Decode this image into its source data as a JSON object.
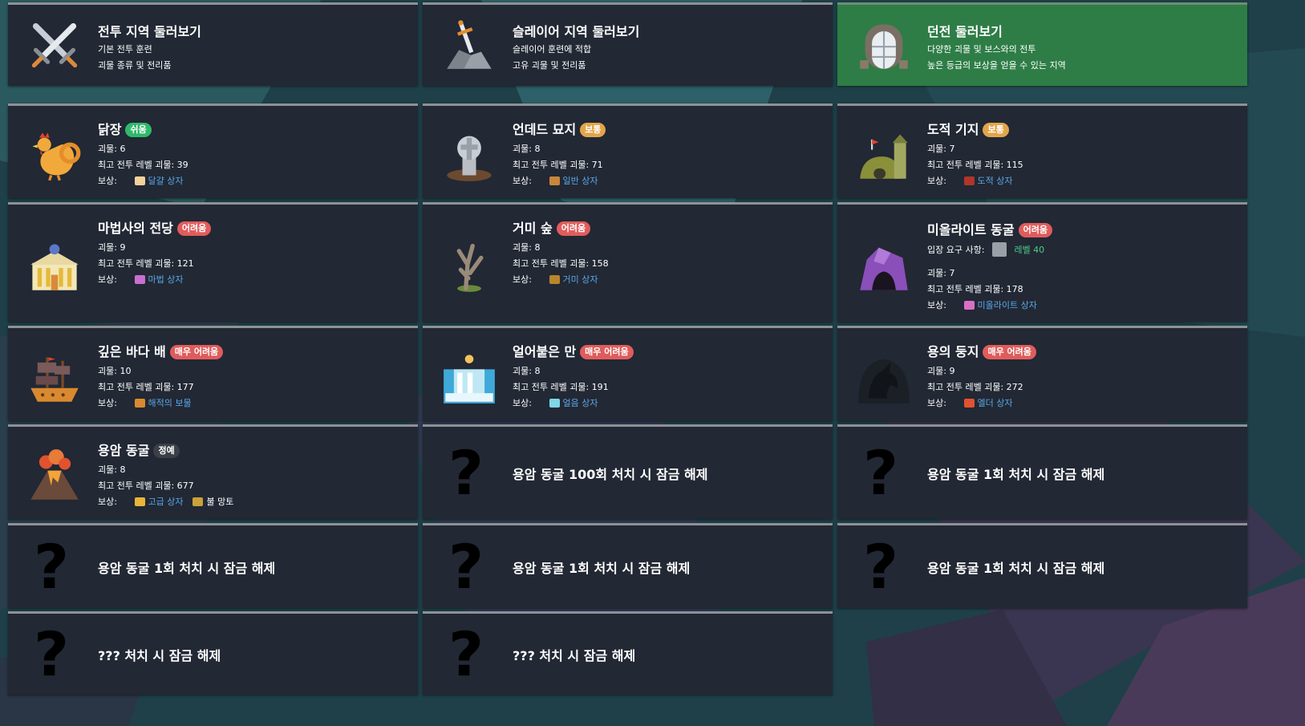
{
  "top_cards": [
    {
      "title": "전투 지역 둘러보기",
      "line1": "기본 전투 훈련",
      "line2": "괴물 종류 및 전리품",
      "icon": "crossed-swords-icon"
    },
    {
      "title": "슬레이어 지역 둘러보기",
      "line1": "슬레이어 훈련에 적합",
      "line2": "고유 괴물 및 전리품",
      "icon": "sword-in-stone-icon"
    },
    {
      "title": "던전 둘러보기",
      "line1": "다양한 괴물 및 보스와의 전투",
      "line2": "높은 등급의 보상을 얻을 수 있는 지역",
      "icon": "dungeon-door-icon",
      "color": "#2e7d46"
    }
  ],
  "labels": {
    "monsters": "괴물:",
    "max_level": "최고 전투 레벨 괴물:",
    "reward": "보상:",
    "requirement": "입장 요구 사항:"
  },
  "areas": [
    {
      "name": "닭장",
      "difficulty": "쉬움",
      "monsters": "6",
      "max_level": "39",
      "reward": "달걀 상자",
      "icon": "rooster-icon",
      "reward_color": "#f2d29b"
    },
    {
      "name": "언데드 묘지",
      "difficulty": "보통",
      "monsters": "8",
      "max_level": "71",
      "reward": "일반 상자",
      "icon": "gravestone-icon",
      "reward_color": "#c8873a"
    },
    {
      "name": "도적 기지",
      "difficulty": "보통",
      "monsters": "7",
      "max_level": "115",
      "reward": "도적 상자",
      "icon": "bandit-base-icon",
      "reward_color": "#b0362a"
    },
    {
      "name": "마법사의 전당",
      "difficulty": "어려움",
      "monsters": "9",
      "max_level": "121",
      "reward": "마법 상자",
      "icon": "wizard-hall-icon",
      "reward_color": "#c86fd1"
    },
    {
      "name": "거미 숲",
      "difficulty": "어려움",
      "monsters": "8",
      "max_level": "158",
      "reward": "거미 상자",
      "icon": "dead-tree-icon",
      "reward_color": "#b8862b"
    },
    {
      "name": "미올라이트 동굴",
      "difficulty": "어려움",
      "requirement": "레벨 40",
      "monsters": "7",
      "max_level": "178",
      "reward": "미올라이트 상자",
      "icon": "crystal-cave-icon",
      "reward_color": "#d96fc4"
    },
    {
      "name": "깊은 바다 배",
      "difficulty": "매우 어려움",
      "monsters": "10",
      "max_level": "177",
      "reward": "해적의 보물",
      "icon": "pirate-ship-icon",
      "reward_color": "#d9892f"
    },
    {
      "name": "얼어붙은 만",
      "difficulty": "매우 어려움",
      "monsters": "8",
      "max_level": "191",
      "reward": "얼음 상자",
      "icon": "frozen-waterfall-icon",
      "reward_color": "#7fd6e6"
    },
    {
      "name": "용의 둥지",
      "difficulty": "매우 어려움",
      "monsters": "9",
      "max_level": "272",
      "reward": "엘더 상자",
      "icon": "dragon-icon",
      "reward_color": "#e0532e"
    },
    {
      "name": "용암 동굴",
      "difficulty": "정예",
      "monsters": "8",
      "max_level": "677",
      "reward": "고급 상자",
      "reward2": "불 망토",
      "icon": "volcano-icon",
      "reward_color": "#e8b43a"
    }
  ],
  "locked": [
    "용암 동굴 100회 처치 시 잠금 해제",
    "용암 동굴 1회 처치 시 잠금 해제",
    "용암 동굴 1회 처치 시 잠금 해제",
    "용암 동굴 1회 처치 시 잠금 해제",
    "용암 동굴 1회 처치 시 잠금 해제",
    "??? 처치 시 잠금 해제",
    "??? 처치 시 잠금 해제"
  ],
  "locked_mark": "?",
  "colors": {
    "card": "#222834",
    "card_border": "#8e9196",
    "easy": "#2fb96a",
    "normal": "#e3a54a",
    "hard": "#e05c5c",
    "elite": "#3b3f47",
    "link": "#5aa8e8",
    "requirement": "#4fc98a"
  }
}
